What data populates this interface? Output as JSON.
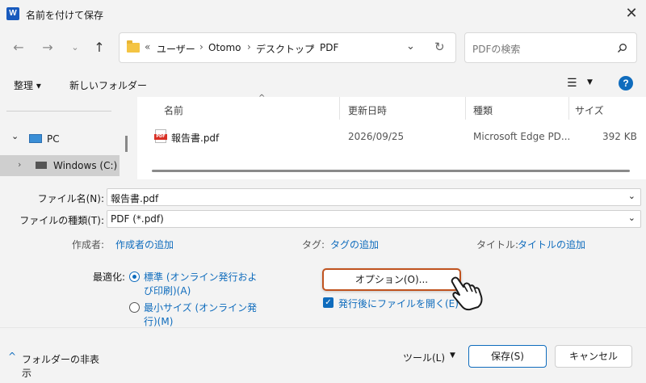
{
  "window": {
    "title": "名前を付けて保存",
    "app_icon_letter": "W",
    "close_glyph": "✕"
  },
  "address_bar": {
    "overflow": "«",
    "crumbs": [
      "ユーザー",
      "Otomo",
      "デスクトップ",
      "PDF"
    ]
  },
  "search": {
    "placeholder": "PDFの検索"
  },
  "toolbar": {
    "organize": "整理 ▾",
    "new_folder": "新しいフォルダー"
  },
  "nav_pane": {
    "items": [
      {
        "label": "PC"
      },
      {
        "label": "Windows (C:)"
      }
    ]
  },
  "file_list": {
    "columns": [
      "名前",
      "更新日時",
      "種類",
      "サイズ"
    ],
    "rows": [
      {
        "name": "報告書.pdf",
        "modified": "2026/09/25",
        "type": "Microsoft Edge PD...",
        "size": "392 KB",
        "icon_text": "PDF"
      }
    ]
  },
  "form": {
    "filename_label": "ファイル名(N):",
    "filename_value": "報告書.pdf",
    "filetype_label": "ファイルの種類(T):",
    "filetype_value": "PDF (*.pdf)",
    "author_label": "作成者:",
    "author_link": "作成者の追加",
    "tags_label": "タグ:",
    "tags_link": "タグの追加",
    "title_label": "タイトル:",
    "title_link": "タイトルの追加",
    "optimize_label": "最適化:",
    "optimize_standard_line1": "標準 (オンライン発行およ",
    "optimize_standard_line2": "び印刷)(A)",
    "optimize_min_line1": "最小サイズ (オンライン発",
    "optimize_min_line2": "行)(M)",
    "options_button": "オプション(O)...",
    "open_after_publish": "発行後にファイルを開く(E)",
    "open_after_publish_checked": true
  },
  "footer": {
    "hide_folders": "フォルダーの非表示",
    "tools": "ツール(L)",
    "save": "保存(S)",
    "cancel": "キャンセル"
  },
  "colors": {
    "accent": "#0f6cbd",
    "highlight_border": "#c0531f",
    "pdf_icon": "#d93025",
    "folder": "#f4c443"
  }
}
